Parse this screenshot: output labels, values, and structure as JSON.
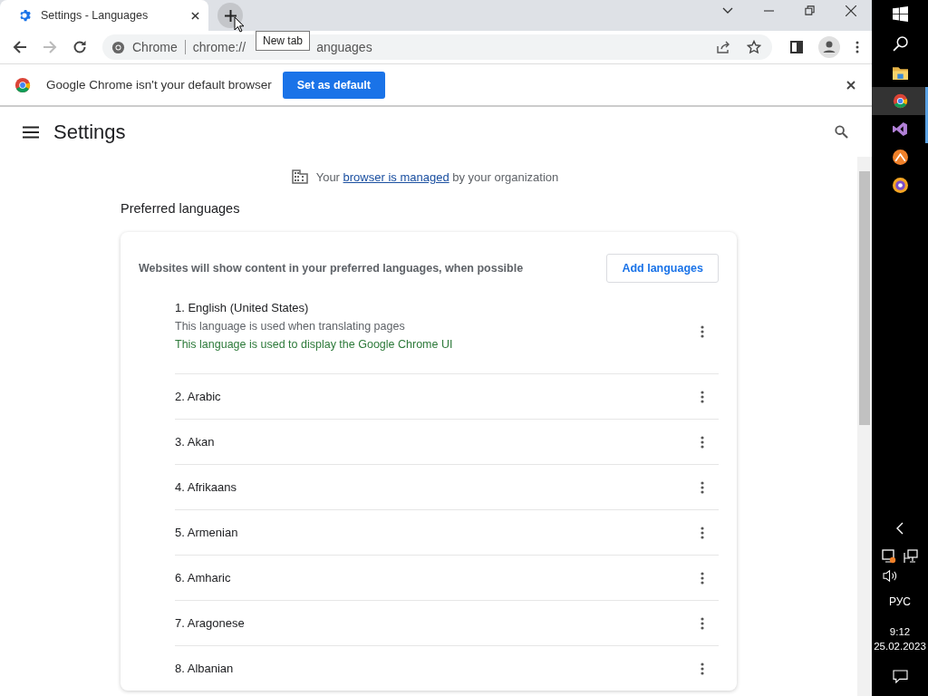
{
  "browser_tab": {
    "title": "Settings - Languages",
    "selected": true
  },
  "new_tab_tooltip": "New tab",
  "address_bar": {
    "site_label": "Chrome",
    "url_start": "chrome://",
    "url_end": "anguages"
  },
  "infobar": {
    "message": "Google Chrome isn't your default browser",
    "button": "Set as default"
  },
  "settings_header": {
    "title": "Settings"
  },
  "managed_notice": {
    "before": "Your",
    "link": "browser is managed",
    "after": "by your organization"
  },
  "section_title": "Preferred languages",
  "card": {
    "description": "Websites will show content in your preferred languages, when possible",
    "add_button": "Add languages",
    "languages": [
      {
        "name": "1. English (United States)",
        "notes": [
          {
            "text": "This language is used when translating pages",
            "kind": "plain"
          },
          {
            "text": "This language is used to display the Google Chrome UI",
            "kind": "ui"
          }
        ]
      },
      {
        "name": "2. Arabic"
      },
      {
        "name": "3. Akan"
      },
      {
        "name": "4. Afrikaans"
      },
      {
        "name": "5. Armenian"
      },
      {
        "name": "6. Amharic"
      },
      {
        "name": "7. Aragonese"
      },
      {
        "name": "8. Albanian"
      }
    ]
  },
  "taskbar": {
    "apps": [
      {
        "kind": "explorer",
        "selected": false,
        "running": false
      },
      {
        "kind": "chrome",
        "selected": true,
        "running": true
      },
      {
        "kind": "studio",
        "selected": false,
        "running": true
      },
      {
        "kind": "orange",
        "selected": false,
        "running": false
      },
      {
        "kind": "purple",
        "selected": false,
        "running": false
      }
    ],
    "language": "РУС",
    "time": "9:12",
    "date": "25.02.2023"
  }
}
